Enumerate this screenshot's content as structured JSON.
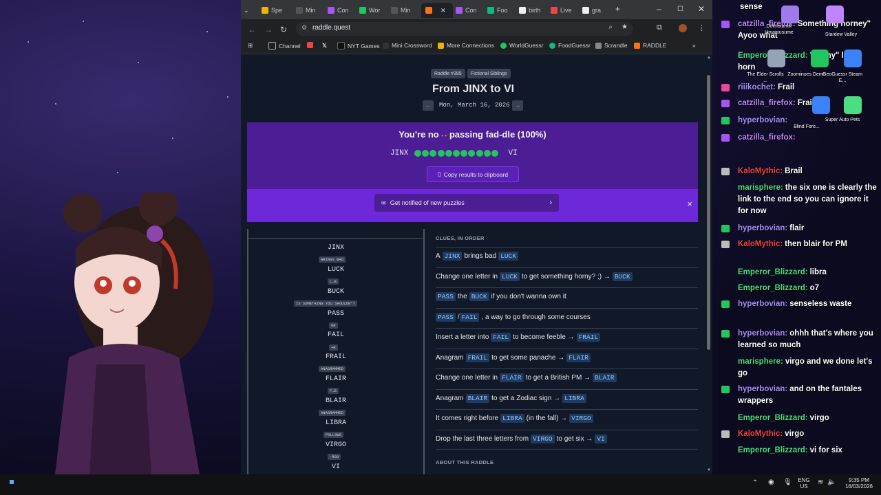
{
  "browser": {
    "tabs": [
      "Spe",
      "Min",
      "Con",
      "Wor",
      "Min",
      "",
      "Con",
      "Foo",
      "birth",
      "Live",
      "gra"
    ],
    "url": "raddle.quest",
    "bookmarks": [
      "Channel",
      "NYT Games",
      "Mini Crossword",
      "More Connections",
      "WorldGuessr",
      "FoodGuessr",
      "Scrandle",
      "RADDLE"
    ]
  },
  "puzzle": {
    "number_pill": "Raddle #385",
    "theme_pill": "Fictional Siblings",
    "title": "From JINX to VI",
    "date": "Mon, March 16, 2026",
    "prev_arrow": "←",
    "next_arrow": "→"
  },
  "result": {
    "headline_a": "You're no",
    "headline_b": "passing fad-dle (100%)",
    "start_word": "JINX",
    "end_word": "VI",
    "dots": 11,
    "copy_label": "Copy results to clipboard"
  },
  "notify": {
    "label": "Get notified of new puzzles",
    "close": "×"
  },
  "ladder": {
    "words": [
      "JINX",
      "LUCK",
      "BUCK",
      "PASS",
      "FAIL",
      "FRAIL",
      "FLAIR",
      "BLAIR",
      "LIBRA",
      "VIRGO",
      "VI"
    ],
    "connectors": [
      "BRINGS BAD",
      "L→B",
      "IS SOMETHING YOU SHOULDN'T",
      "OR",
      "+R",
      "ANAGRAMMED",
      "F→B",
      "ANAGRAMMED",
      "FOLLOWS",
      "-RGO"
    ]
  },
  "clues": {
    "heading": "CLUES, IN ORDER",
    "about_heading": "ABOUT THIS RADDLE",
    "items": [
      {
        "a": "A",
        "w1": "JINX",
        "b": "brings bad",
        "w2": "LUCK"
      },
      {
        "a": "Change one letter in",
        "w1": "LUCK",
        "b": "to get something horny? ;) →",
        "w2": "BUCK"
      },
      {
        "a": "",
        "w1": "PASS",
        "b": "the",
        "w2": "BUCK",
        "c": "if you don't wanna own it"
      },
      {
        "a": "",
        "w1": "PASS",
        "sep": "/",
        "w2": "FAIL",
        "c": ", a way to go through some courses"
      },
      {
        "a": "Insert a letter into",
        "w1": "FAIL",
        "b": "to become feeble →",
        "w2": "FRAIL"
      },
      {
        "a": "Anagram",
        "w1": "FRAIL",
        "b": "to get some panache →",
        "w2": "FLAIR"
      },
      {
        "a": "Change one letter in",
        "w1": "FLAIR",
        "b": "to get a British PM →",
        "w2": "BLAIR"
      },
      {
        "a": "Anagram",
        "w1": "BLAIR",
        "b": "to get a Zodiac sign →",
        "w2": "LIBRA"
      },
      {
        "a": "It comes right before",
        "w1": "LIBRA",
        "b": "(in the fall) →",
        "w2": "VIRGO"
      },
      {
        "a": "Drop the last three letters from",
        "w1": "VIRGO",
        "b": "to get six →",
        "w2": "VI"
      }
    ]
  },
  "chat": [
    {
      "user": "",
      "text": "sense",
      "color": "#ffffff"
    },
    {
      "user": "catzilla_firefox:",
      "text": "Something horney\" Ayoo what",
      "color": "#c084fc"
    },
    {
      "user": "Emperor_Blizzard:",
      "text": "\"horny\" like a horn",
      "color": "#4ade80"
    },
    {
      "user": "riiikochet:",
      "text": "Frail",
      "color": "#a78bfa"
    },
    {
      "user": "catzilla_firefox:",
      "text": "Frail",
      "color": "#c084fc"
    },
    {
      "user": "hyperbovian:",
      "text": "",
      "color": "#a78bfa"
    },
    {
      "user": "catzilla_firefox:",
      "text": "",
      "color": "#c084fc"
    },
    {
      "user": "KaloMythic:",
      "text": "Brail",
      "color": "#ef4444"
    },
    {
      "user": "marisphere:",
      "text": "the six one is clearly the link to the end so you can ignore it for now",
      "color": "#4ade80"
    },
    {
      "user": "hyperbovian:",
      "text": "flair",
      "color": "#a78bfa"
    },
    {
      "user": "KaloMythic:",
      "text": "then blair for PM",
      "color": "#ef4444"
    },
    {
      "user": "Emperor_Blizzard:",
      "text": "libra",
      "color": "#4ade80"
    },
    {
      "user": "Emperor_Blizzard:",
      "text": "o7",
      "color": "#4ade80"
    },
    {
      "user": "hyperbovian:",
      "text": "senseless waste",
      "color": "#a78bfa"
    },
    {
      "user": "hyperbovian:",
      "text": "ohhh that's where you learned so much",
      "color": "#a78bfa"
    },
    {
      "user": "marisphere:",
      "text": "virgo and we done let's go",
      "color": "#4ade80"
    },
    {
      "user": "hyperbovian:",
      "text": "and on the fantales wrappers",
      "color": "#a78bfa"
    },
    {
      "user": "Emperor_Blizzard:",
      "text": "virgo",
      "color": "#4ade80"
    },
    {
      "user": "KaloMythic:",
      "text": "virgo",
      "color": "#ef4444"
    },
    {
      "user": "Emperor_Blizzard:",
      "text": "vi for six",
      "color": "#4ade80"
    }
  ],
  "desktop_icons": [
    "Dolmotantik Umamusume",
    "Stardew Valley",
    "The Elder Scrolls ...",
    "Zoominoes Demo",
    "GeoGuessr Steam E...",
    "Blind Fore...",
    "Super Auto Pets"
  ],
  "taskbar": {
    "lang": "ENG",
    "region": "US",
    "time": "9:35 PM",
    "date": "16/03/2026"
  }
}
